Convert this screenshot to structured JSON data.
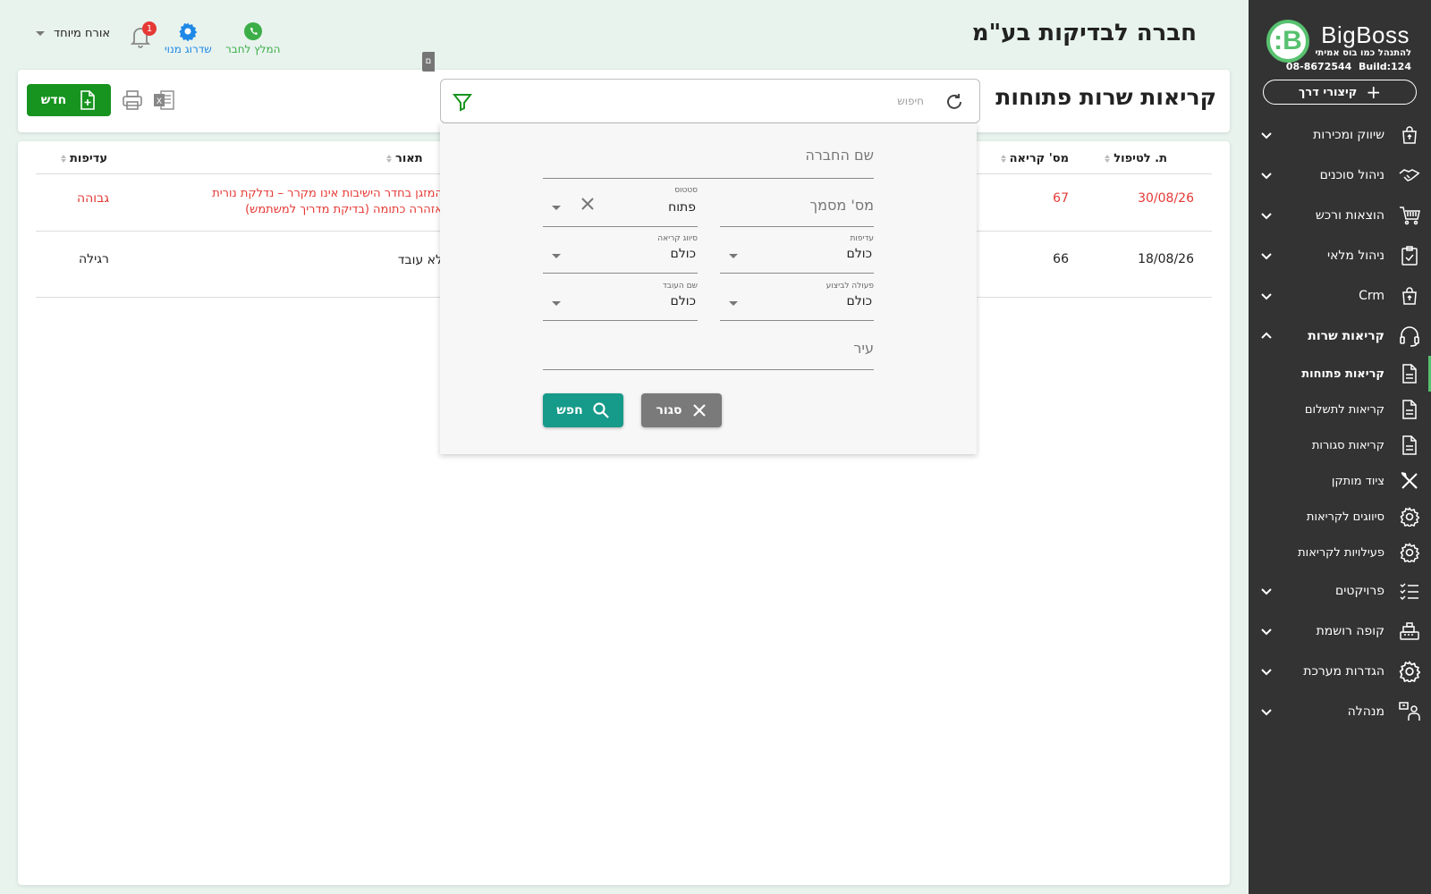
{
  "header": {
    "company_title": "חברה לבדיקות בע\"מ",
    "user_name": "אורח מיוחד",
    "notification_count": "1",
    "whatsapp_label": "המלץ לחבר",
    "upgrade_label": "שדרוג מנוי"
  },
  "sidebar": {
    "logo_text": "BigBoss",
    "logo_letter": "B:",
    "tagline": "להתנהל כמו בוס אמיתי",
    "phone": "08-8672544",
    "build": "Build:124",
    "shortcuts_label": "קיצורי דרך",
    "items": [
      {
        "label": "שיווק ומכירות",
        "icon": "shopping-bag-icon"
      },
      {
        "label": "ניהול סוכנים",
        "icon": "handshake-icon"
      },
      {
        "label": "הוצאות ורכש",
        "icon": "cart-icon"
      },
      {
        "label": "ניהול מלאי",
        "icon": "clipboard-check-icon"
      },
      {
        "label": "Crm",
        "icon": "shopping-bag-icon"
      },
      {
        "label": "קריאות שרות",
        "icon": "headset-icon"
      }
    ],
    "sub_items": [
      {
        "label": "קריאות פתוחות",
        "icon": "document-icon"
      },
      {
        "label": "קריאות לתשלום",
        "icon": "document-icon"
      },
      {
        "label": "קריאות סגורות",
        "icon": "document-icon"
      },
      {
        "label": "ציוד מותקן",
        "icon": "tools-icon"
      },
      {
        "label": "סיווגים לקריאות",
        "icon": "gear-icon"
      },
      {
        "label": "פעילויות לקריאות",
        "icon": "gear-icon"
      }
    ],
    "bottom_items": [
      {
        "label": "פרויקטים",
        "icon": "checklist-icon"
      },
      {
        "label": "קופה רושמת",
        "icon": "cash-register-icon"
      },
      {
        "label": "הגדרות מערכת",
        "icon": "gear-icon"
      },
      {
        "label": "מנהלה",
        "icon": "admin-icon"
      }
    ]
  },
  "toolbar": {
    "page_title": "קריאות שרות פתוחות",
    "search_placeholder": "חיפוש",
    "new_label": "חדש"
  },
  "table": {
    "headers": [
      "ת. לטיפול",
      "מס' קריאה",
      "תאור",
      "עדיפות"
    ],
    "rows": [
      {
        "date": "30/08/26",
        "number": "67",
        "description_line1": "המזגן בחדר הישיבות אינו מקרר – נדלקת נורית",
        "description_line2": "אזהרה כתומה (בדיקת מדריך למשתמש)",
        "priority": "גבוהה"
      },
      {
        "date": "18/08/26",
        "number": "66",
        "description_line1": "לא עובד",
        "description_line2": "",
        "priority": "רגילה"
      }
    ]
  },
  "filter": {
    "company_placeholder": "שם החברה",
    "doc_number_placeholder": "מס' מסמך",
    "status_label": "סטטוס",
    "status_value": "פתוח",
    "priority_label": "עדיפות",
    "priority_value": "כולם",
    "call_type_label": "סיווג קריאה",
    "call_type_value": "כולם",
    "action_label": "פעולה לביצוע",
    "action_value": "כולם",
    "employee_label": "שם העובד",
    "employee_value": "כולם",
    "city_placeholder": "עיר",
    "search_button": "חפש",
    "close_button": "סגור",
    "tooltip_fragment": "ם"
  },
  "colors": {
    "sidebar_bg": "#333333",
    "brand_green": "#57c16f",
    "new_button": "#17941f",
    "search_button": "#169a8a",
    "close_button": "#7a7a7a",
    "high_priority": "#e53935",
    "page_bg": "#e8f3ee"
  }
}
